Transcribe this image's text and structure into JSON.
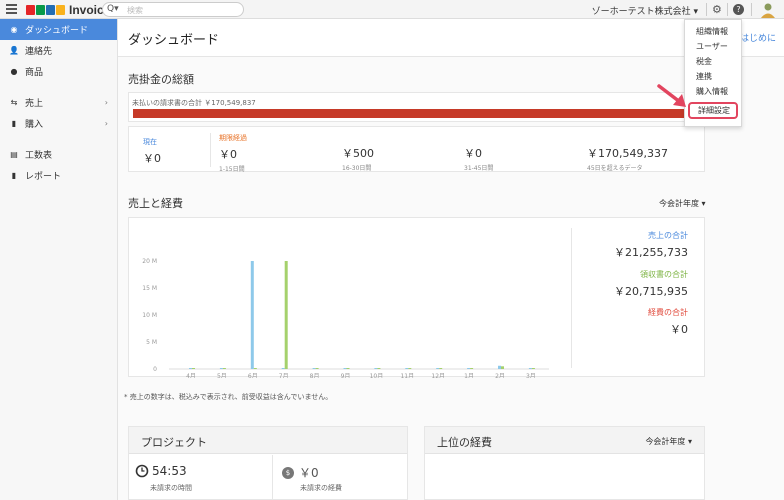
{
  "topbar": {
    "brand": "Invoice",
    "search_icon": "Q▾",
    "search_placeholder": "検索",
    "org_name": "ゾーホーテスト株式会社 ▾",
    "settings_icon": "gear-icon",
    "help_icon": "help-icon",
    "zoho_colors": [
      "#e42527",
      "#089949",
      "#226db4",
      "#f9b21d"
    ]
  },
  "sidebar": {
    "items": [
      {
        "label": "ダッシュボード",
        "icon": "dashboard-icon"
      },
      {
        "label": "連絡先",
        "icon": "contacts-icon"
      },
      {
        "label": "商品",
        "icon": "items-icon"
      },
      {
        "label": "売上",
        "icon": "sales-icon",
        "chevron": "›"
      },
      {
        "label": "購入",
        "icon": "purchases-icon",
        "chevron": "›"
      },
      {
        "label": "工数表",
        "icon": "timesheet-icon"
      },
      {
        "label": "レポート",
        "icon": "reports-icon"
      }
    ]
  },
  "header": {
    "title": "ダッシュボード",
    "getting_started": "はじめに"
  },
  "receivables": {
    "title": "売掛金の総額",
    "unpaid_label": "未払いの請求書の合計 ￥170,549,837",
    "current_label": "現在",
    "current_value": "￥0",
    "overdue_label": "期限経過",
    "buckets": [
      {
        "value": "￥0",
        "range": "1-15日間"
      },
      {
        "value": "￥500",
        "range": "16-30日間"
      },
      {
        "value": "￥0",
        "range": "31-45日間"
      },
      {
        "value": "￥170,549,337",
        "range": "45日を超えるデータ"
      }
    ],
    "bar_color": "#c63a28"
  },
  "sales_expenses": {
    "title": "売上と経費",
    "period": "今会計年度 ▾",
    "sales_total_label": "売上の合計",
    "sales_total": "￥21,255,733",
    "receipts_total_label": "領収書の合計",
    "receipts_total": "￥20,715,935",
    "expenses_total_label": "経費の合計",
    "expenses_total": "￥0",
    "footnote": "* 売上の数字は、税込みで表示され、前受収益は含んでいません。",
    "colors": {
      "sales": "#8ec9ea",
      "receipts": "#a5d16c",
      "expenses": "#e8746a"
    }
  },
  "chart_data": {
    "type": "bar",
    "categories": [
      "4月\n2014",
      "5月\n2014",
      "6月\n2014",
      "7月\n2014",
      "8月\n2014",
      "9月\n2014",
      "10月\n2014",
      "11月\n2014",
      "12月\n2014",
      "1月\n2015",
      "2月\n2015",
      "3月\n2015"
    ],
    "series": [
      {
        "name": "売上",
        "values": [
          0.05,
          0.05,
          20.0,
          0.05,
          0.05,
          0.05,
          0.05,
          0.05,
          0.05,
          0.1,
          0.6,
          0.05
        ]
      },
      {
        "name": "領収書",
        "values": [
          0.05,
          0.05,
          0.05,
          20.0,
          0.05,
          0.05,
          0.05,
          0.05,
          0.05,
          0.1,
          0.5,
          0.05
        ]
      }
    ],
    "yticks": [
      "0",
      "5 M",
      "10 M",
      "15 M",
      "20 M"
    ],
    "ylim": [
      0,
      20
    ],
    "grid": false,
    "legend": "right"
  },
  "projects": {
    "title": "プロジェクト",
    "unbilled_hours": "54:53",
    "unbilled_hours_label": "未請求の時間",
    "unbilled_expenses": "￥0",
    "unbilled_expenses_label": "未請求の経費"
  },
  "top_expenses": {
    "title": "上位の経費",
    "period": "今会計年度 ▾"
  },
  "settings_menu": {
    "items": [
      "組織情報",
      "ユーザー",
      "税金",
      "連携",
      "購入情報"
    ],
    "highlighted_item": "詳細設定",
    "highlight_color": "#e2455f"
  }
}
